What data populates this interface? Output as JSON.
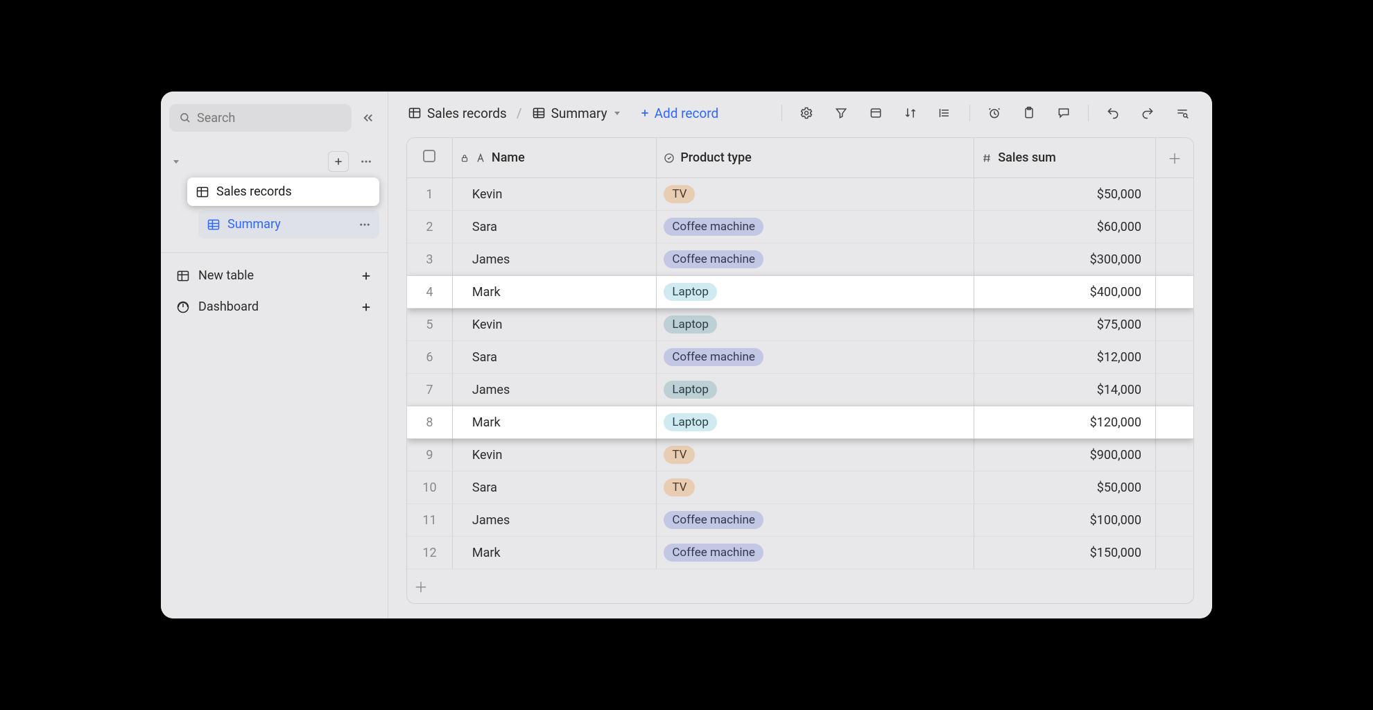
{
  "search": {
    "placeholder": "Search"
  },
  "sidebar": {
    "tableName": "Sales records",
    "viewName": "Summary",
    "items": [
      {
        "label": "New table"
      },
      {
        "label": "Dashboard"
      }
    ]
  },
  "toolbar": {
    "breadcrumb": {
      "table": "Sales records",
      "view": "Summary"
    },
    "addRecord": "Add record"
  },
  "table": {
    "columns": {
      "name": "Name",
      "productType": "Product type",
      "salesSum": "Sales sum"
    },
    "rows": [
      {
        "num": "1",
        "name": "Kevin",
        "product": "TV",
        "productTag": "tv",
        "sum": "$50,000",
        "highlight": false
      },
      {
        "num": "2",
        "name": "Sara",
        "product": "Coffee machine",
        "productTag": "coffee",
        "sum": "$60,000",
        "highlight": false
      },
      {
        "num": "3",
        "name": "James",
        "product": "Coffee machine",
        "productTag": "coffee",
        "sum": "$300,000",
        "highlight": false
      },
      {
        "num": "4",
        "name": "Mark",
        "product": "Laptop",
        "productTag": "laptop-hl",
        "sum": "$400,000",
        "highlight": true
      },
      {
        "num": "5",
        "name": "Kevin",
        "product": "Laptop",
        "productTag": "laptop-dim",
        "sum": "$75,000",
        "highlight": false
      },
      {
        "num": "6",
        "name": "Sara",
        "product": "Coffee machine",
        "productTag": "coffee",
        "sum": "$12,000",
        "highlight": false
      },
      {
        "num": "7",
        "name": "James",
        "product": "Laptop",
        "productTag": "laptop-dim",
        "sum": "$14,000",
        "highlight": false
      },
      {
        "num": "8",
        "name": "Mark",
        "product": "Laptop",
        "productTag": "laptop-hl",
        "sum": "$120,000",
        "highlight": true
      },
      {
        "num": "9",
        "name": "Kevin",
        "product": "TV",
        "productTag": "tv",
        "sum": "$900,000",
        "highlight": false
      },
      {
        "num": "10",
        "name": "Sara",
        "product": "TV",
        "productTag": "tv",
        "sum": "$50,000",
        "highlight": false
      },
      {
        "num": "11",
        "name": "James",
        "product": "Coffee machine",
        "productTag": "coffee",
        "sum": "$100,000",
        "highlight": false
      },
      {
        "num": "12",
        "name": "Mark",
        "product": "Coffee machine",
        "productTag": "coffee",
        "sum": "$150,000",
        "highlight": false
      }
    ]
  }
}
